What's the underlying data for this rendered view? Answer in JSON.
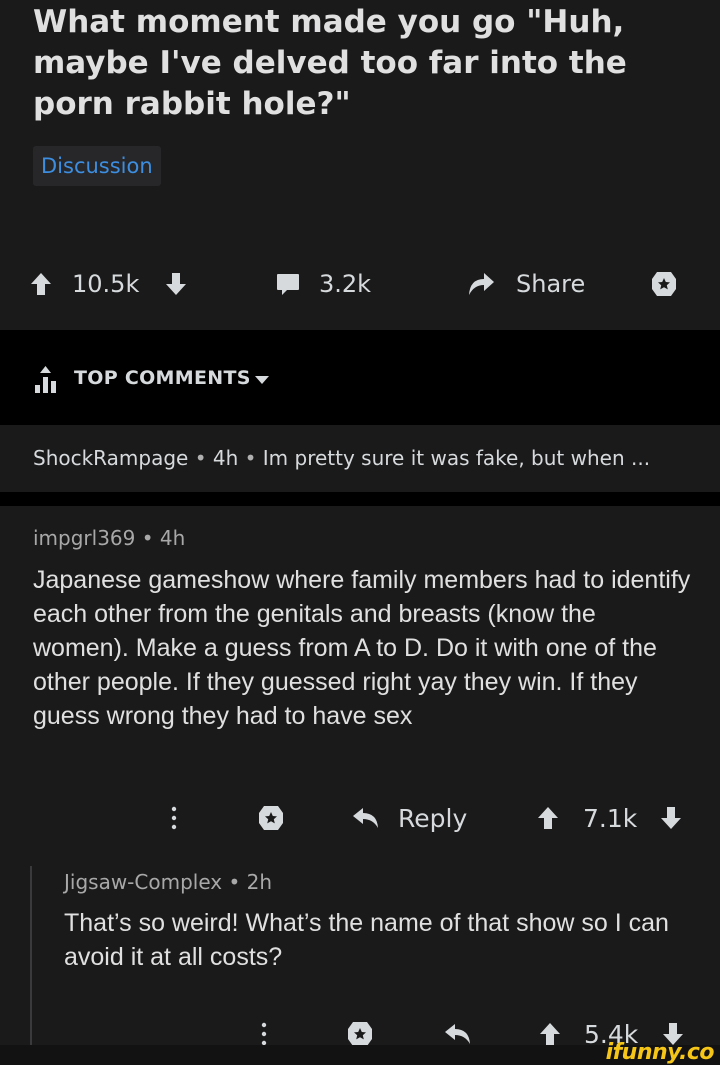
{
  "post": {
    "title": "What moment made you go \"Huh, maybe I've delved too far into the porn rabbit hole?\"",
    "flair": "Discussion",
    "upvotes": "10.5k",
    "comments": "3.2k",
    "share_label": "Share"
  },
  "sort": {
    "label": "TOP COMMENTS"
  },
  "collapsed_comment": {
    "author": "ShockRampage",
    "age": "4h",
    "preview": "Im pretty sure it was fake, but when ..."
  },
  "comment": {
    "author": "impgrl369",
    "age": "4h",
    "body": "Japanese gameshow where family members had to identify each other from the genitals and breasts (know the women). Make a guess from A to D. Do it with one of the other people. If they guessed right yay they win. If they guess wrong they had to have sex",
    "reply_label": "Reply",
    "score": "7.1k"
  },
  "reply": {
    "author": "Jigsaw-Complex",
    "age": "2h",
    "body": "That’s so weird!  What’s the name of that show so I can avoid it at all costs?",
    "score": "5.4k"
  },
  "separator": "•",
  "watermark": "ifunny.co",
  "colors": {
    "background": "#1a1a1b",
    "black_bar": "#000000",
    "flair_text": "#3d8ee0",
    "watermark": "#f5c518"
  },
  "icons": [
    "upvote-icon",
    "downvote-icon",
    "comment-icon",
    "share-icon",
    "award-icon",
    "top-sort-icon",
    "caret-down-icon",
    "more-icon",
    "reply-icon"
  ]
}
